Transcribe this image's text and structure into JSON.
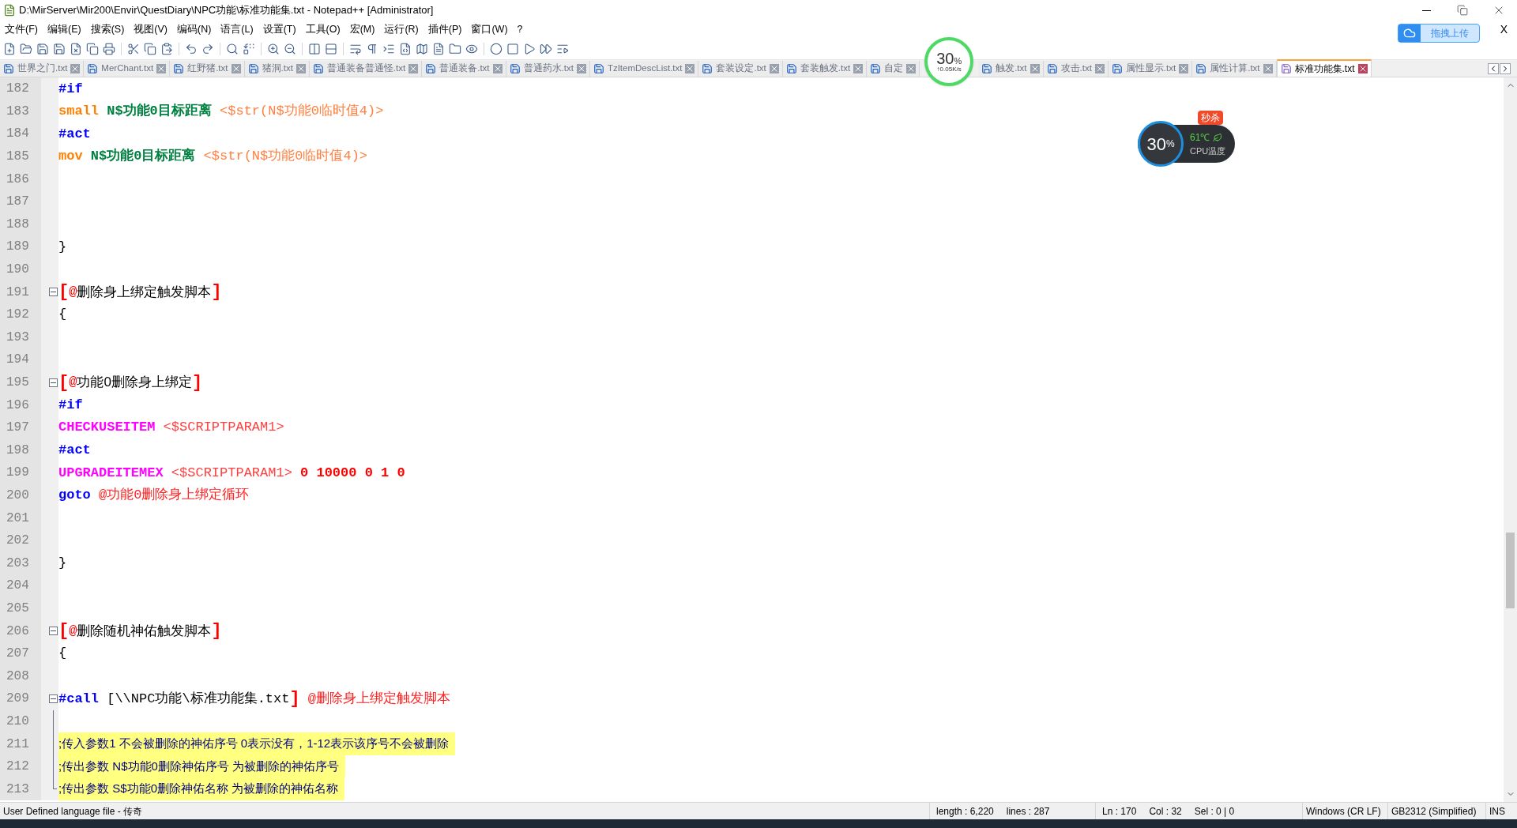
{
  "window": {
    "title": "D:\\MirServer\\Mir200\\Envir\\QuestDiary\\NPC功能\\标准功能集.txt - Notepad++ [Administrator]"
  },
  "menu": [
    "文件(F)",
    "编辑(E)",
    "搜索(S)",
    "视图(V)",
    "编码(N)",
    "语言(L)",
    "设置(T)",
    "工具(O)",
    "宏(M)",
    "运行(R)",
    "插件(P)",
    "窗口(W)",
    "?"
  ],
  "menu_close": "X",
  "upload_button": "拖拽上传",
  "tabs": [
    {
      "label": "世界之门.txt",
      "selected": false
    },
    {
      "label": "MerChant.txt",
      "selected": false
    },
    {
      "label": "红野猪.txt",
      "selected": false
    },
    {
      "label": "猪洞.txt",
      "selected": false
    },
    {
      "label": "普通装备普通怪.txt",
      "selected": false
    },
    {
      "label": "普通装备.txt",
      "selected": false
    },
    {
      "label": "普通药水.txt",
      "selected": false
    },
    {
      "label": "TzItemDescList.txt",
      "selected": false
    },
    {
      "label": "套装设定.txt",
      "selected": false
    },
    {
      "label": "套装触发.txt",
      "selected": false
    },
    {
      "label": "自定",
      "selected": false
    },
    {
      "label": "触发.txt",
      "selected": false
    },
    {
      "label": "攻击.txt",
      "selected": false
    },
    {
      "label": "属性显示.txt",
      "selected": false
    },
    {
      "label": "属性计算.txt",
      "selected": false
    },
    {
      "label": "标准功能集.txt",
      "selected": true
    }
  ],
  "editor": {
    "lines": [
      {
        "no": "182",
        "tokens": [
          {
            "kind": "kw",
            "text": "#if"
          }
        ]
      },
      {
        "no": "183",
        "tokens": [
          {
            "kind": "cmd",
            "text": "small"
          },
          {
            "kind": "var",
            "text": " N$功能0目标距离"
          },
          {
            "kind": "param",
            "text": " <$str(N$功能0临时值4)>"
          }
        ]
      },
      {
        "no": "184",
        "tokens": [
          {
            "kind": "kw",
            "text": "#act"
          }
        ]
      },
      {
        "no": "185",
        "tokens": [
          {
            "kind": "cmd",
            "text": "mov"
          },
          {
            "kind": "var",
            "text": " N$功能0目标距离"
          },
          {
            "kind": "param",
            "text": " <$str(N$功能0临时值4)>"
          }
        ]
      },
      {
        "no": "186"
      },
      {
        "no": "187"
      },
      {
        "no": "188"
      },
      {
        "no": "189",
        "tokens": [
          {
            "kind": "plain",
            "text": "}"
          }
        ]
      },
      {
        "no": "190"
      },
      {
        "no": "191",
        "fold": {
          "kind": "open"
        },
        "tokens": [
          {
            "kind": "bracket",
            "text": "["
          },
          {
            "kind": "at",
            "text": "@"
          },
          {
            "kind": "name",
            "text": "删除身上绑定触发脚本"
          },
          {
            "kind": "bracket",
            "text": "]"
          }
        ]
      },
      {
        "no": "192",
        "tokens": [
          {
            "kind": "plain",
            "text": "{"
          }
        ]
      },
      {
        "no": "193"
      },
      {
        "no": "194"
      },
      {
        "no": "195",
        "fold": {
          "kind": "open"
        },
        "tokens": [
          {
            "kind": "bracket",
            "text": "["
          },
          {
            "kind": "at",
            "text": "@"
          },
          {
            "kind": "name",
            "text": "功能0删除身上绑定"
          },
          {
            "kind": "bracket",
            "text": "]"
          }
        ]
      },
      {
        "no": "196",
        "tokens": [
          {
            "kind": "kw",
            "text": "#if"
          }
        ]
      },
      {
        "no": "197",
        "tokens": [
          {
            "kind": "func",
            "text": "CHECKUSEITEM"
          },
          {
            "kind": "arg",
            "text": " <$SCRIPTPARAM1>"
          }
        ]
      },
      {
        "no": "198",
        "tokens": [
          {
            "kind": "kw",
            "text": "#act"
          }
        ]
      },
      {
        "no": "199",
        "tokens": [
          {
            "kind": "func",
            "text": "UPGRADEITEMEX"
          },
          {
            "kind": "arg",
            "text": " <$SCRIPTPARAM1>"
          },
          {
            "kind": "num",
            "text": " 0 10000 0 1 0"
          }
        ]
      },
      {
        "no": "200",
        "tokens": [
          {
            "kind": "kw",
            "text": "goto"
          },
          {
            "kind": "ref",
            "text": " @功能0删除身上绑定循环"
          }
        ]
      },
      {
        "no": "201"
      },
      {
        "no": "202"
      },
      {
        "no": "203",
        "tokens": [
          {
            "kind": "plain",
            "text": "}"
          }
        ]
      },
      {
        "no": "204"
      },
      {
        "no": "205"
      },
      {
        "no": "206",
        "fold": {
          "kind": "open"
        },
        "tokens": [
          {
            "kind": "bracket",
            "text": "["
          },
          {
            "kind": "at",
            "text": "@"
          },
          {
            "kind": "name",
            "text": "删除随机神佑触发脚本"
          },
          {
            "kind": "bracket",
            "text": "]"
          }
        ]
      },
      {
        "no": "207",
        "tokens": [
          {
            "kind": "plain",
            "text": "{"
          }
        ]
      },
      {
        "no": "208"
      },
      {
        "no": "209",
        "fold": {
          "kind": "open"
        },
        "tokens": [
          {
            "kind": "kw",
            "text": "#call"
          },
          {
            "kind": "plain",
            "text": " [\\\\NPC功能\\标准功能集.txt"
          },
          {
            "kind": "bracket",
            "text": "]"
          },
          {
            "kind": "ref",
            "text": " @删除身上绑定触发脚本"
          }
        ]
      },
      {
        "no": "210",
        "fold": {
          "kind": "line"
        }
      },
      {
        "no": "211",
        "fold": {
          "kind": "line"
        },
        "tokens": [
          {
            "kind": "comment",
            "text": ";传入参数1 不会被删除的神佑序号 0表示没有，1-12表示该序号不会被删除"
          }
        ]
      },
      {
        "no": "212",
        "fold": {
          "kind": "line"
        },
        "tokens": [
          {
            "kind": "comment",
            "text": ";传出参数 N$功能0删除神佑序号 为被删除的神佑序号"
          }
        ]
      },
      {
        "no": "213",
        "fold": {
          "kind": "end"
        },
        "tokens": [
          {
            "kind": "comment",
            "text": ";传出参数 S$功能0删除神佑名称 为被删除的神佑名称"
          }
        ]
      }
    ]
  },
  "status_bar": [
    [
      "User Defined language file - 传奇"
    ],
    [
      "length : 6,220",
      "lines : 287"
    ],
    [
      "Ln : 170",
      "Col : 32",
      "Sel : 0 | 0"
    ],
    [
      "Windows (CR LF)"
    ],
    [
      "GB2312 (Simplified)"
    ],
    [
      "INS"
    ]
  ],
  "net_widget": {
    "percent": "30",
    "unit": "%",
    "speed": "↑0.05K/s"
  },
  "cpu_widget": {
    "badge": "秒杀",
    "percent": "30",
    "unit": "%",
    "temp": "61℃",
    "label": "CPU温度"
  }
}
